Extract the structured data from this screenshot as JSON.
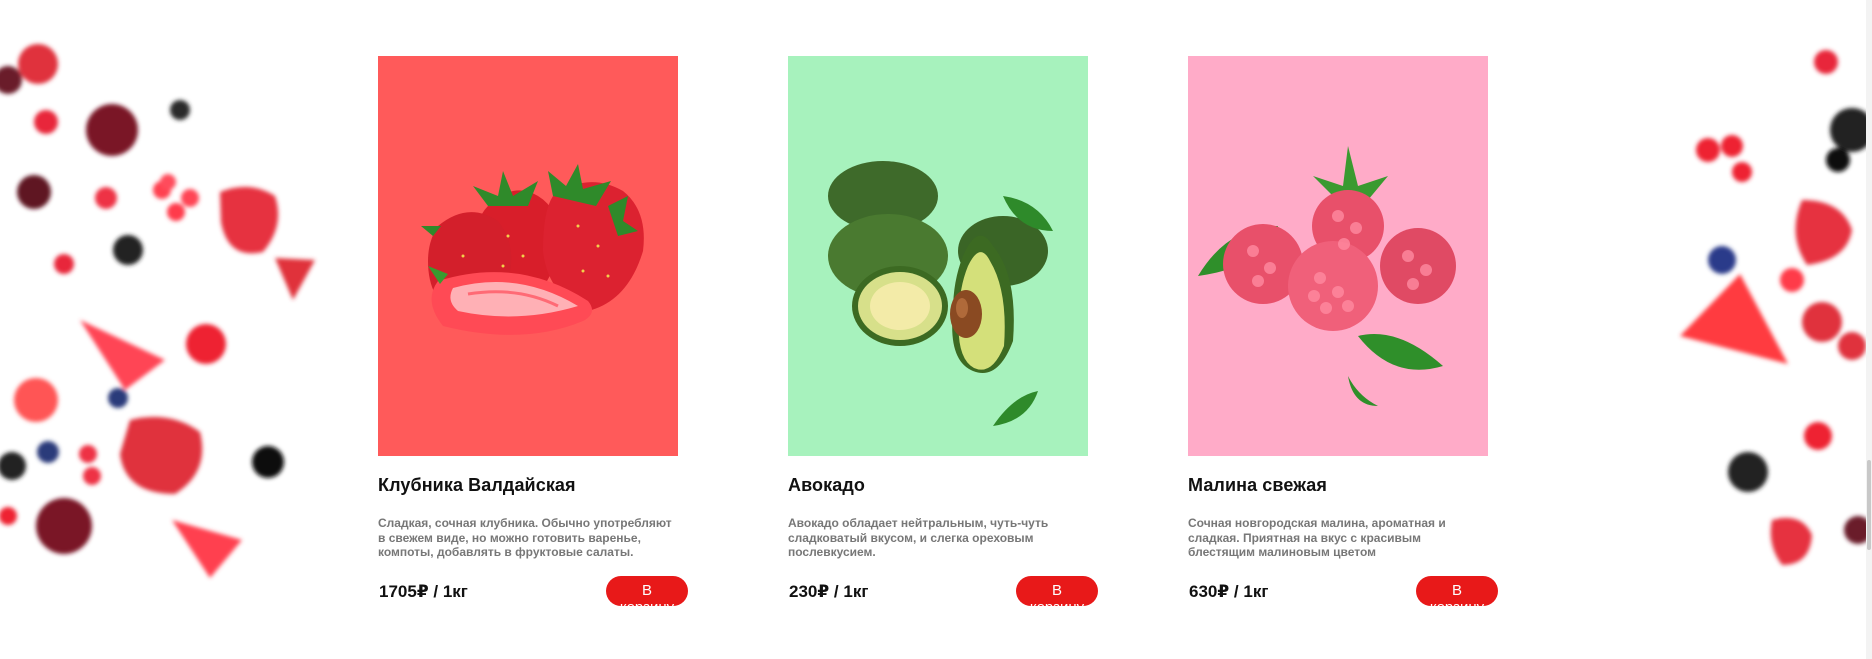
{
  "products": [
    {
      "title": "Клубника Валдайская",
      "description": "Сладкая, сочная клубника. Обычно употребляют в свежем виде, но можно готовить варенье, компоты, добавлять в фруктовые салаты.",
      "price": "1705₽ / 1кг",
      "button_label": "В корзину",
      "image_bg": "#ff5a5a",
      "image_icon": "strawberry-image"
    },
    {
      "title": "Авокадо",
      "description": "Авокадо обладает нейтральным, чуть-чуть сладковатый вкусом, и слегка ореховым послевкусием.",
      "price": "230₽ / 1кг",
      "button_label": "В корзину",
      "image_bg": "#a7f2bd",
      "image_icon": "avocado-image"
    },
    {
      "title": "Малина свежая",
      "description": "Сочная новгородская малина, ароматная и сладкая. Приятная на вкус с красивым блестящим малиновым цветом",
      "price": "630₽ / 1кг",
      "button_label": "В корзину",
      "image_bg": "#ffabc8",
      "image_icon": "raspberry-image"
    }
  ],
  "colors": {
    "button": "#e81919",
    "desc_text": "#777777",
    "title_text": "#111111"
  }
}
